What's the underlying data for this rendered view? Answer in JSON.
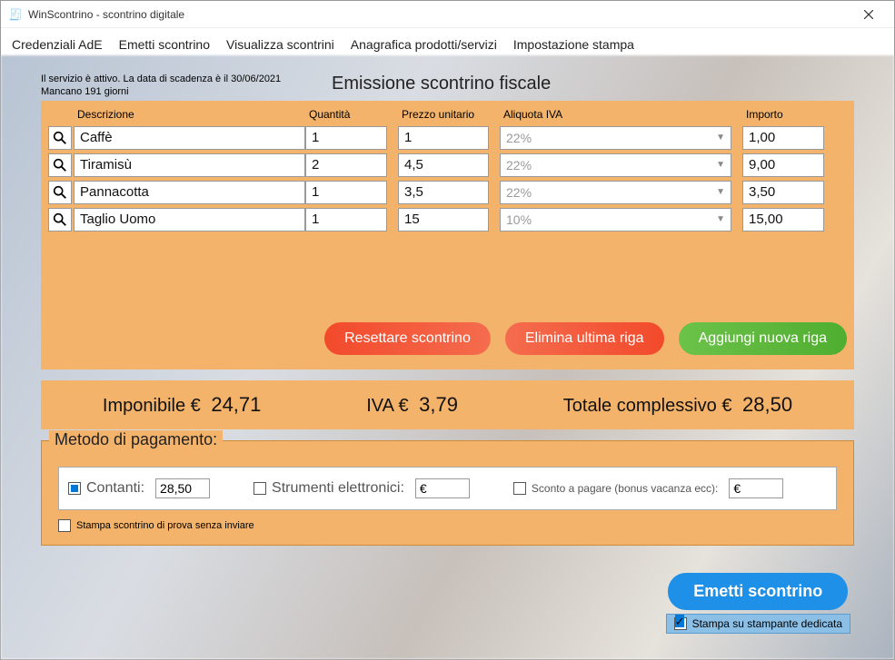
{
  "window": {
    "title": "WinScontrino - scontrino digitale",
    "icon": "receipt-icon"
  },
  "menu": {
    "items": [
      {
        "label": "Credenziali AdE",
        "active": false
      },
      {
        "label": "Emetti scontrino",
        "active": true
      },
      {
        "label": "Visualizza scontrini",
        "active": false
      },
      {
        "label": "Anagrafica prodotti/servizi",
        "active": false
      },
      {
        "label": "Impostazione stampa",
        "active": false
      }
    ]
  },
  "status": {
    "line1": "Il servizio è attivo. La data di scadenza è il 30/06/2021",
    "line2": "Mancano 191 giorni"
  },
  "main_title": "Emissione scontrino fiscale",
  "columns": {
    "descrizione": "Descrizione",
    "quantita": "Quantità",
    "prezzo": "Prezzo unitario",
    "aliquota": "Aliquota IVA",
    "importo": "Importo"
  },
  "rows": [
    {
      "descrizione": "Caffè",
      "quantita": "1",
      "prezzo": "1",
      "aliquota": "22%",
      "importo": "1,00"
    },
    {
      "descrizione": "Tiramisù",
      "quantita": "2",
      "prezzo": "4,5",
      "aliquota": "22%",
      "importo": "9,00"
    },
    {
      "descrizione": "Pannacotta",
      "quantita": "1",
      "prezzo": "3,5",
      "aliquota": "22%",
      "importo": "3,50"
    },
    {
      "descrizione": "Taglio Uomo",
      "quantita": "1",
      "prezzo": "15",
      "aliquota": "10%",
      "importo": "15,00"
    }
  ],
  "buttons": {
    "reset": "Resettare scontrino",
    "delete_last": "Elimina ultima riga",
    "add_row": "Aggiungi nuova riga",
    "emit": "Emetti scontrino"
  },
  "totals": {
    "imponibile_label": "Imponibile  €",
    "imponibile_value": "24,71",
    "iva_label": "IVA €",
    "iva_value": "3,79",
    "totale_label": "Totale complessivo €",
    "totale_value": "28,50"
  },
  "payment": {
    "title": "Metodo di pagamento:",
    "contanti_label": "Contanti:",
    "contanti_value": "28,50",
    "contanti_checked": true,
    "strumenti_label": "Strumenti elettronici:",
    "strumenti_value": "€",
    "strumenti_checked": false,
    "sconto_label": "Sconto a pagare (bonus vacanza ecc):",
    "sconto_value": "€",
    "sconto_checked": false,
    "test_print_label": "Stampa scontrino di prova senza inviare",
    "test_print_checked": false,
    "dedicated_label": "Stampa su stampante dedicata",
    "dedicated_checked": true
  }
}
